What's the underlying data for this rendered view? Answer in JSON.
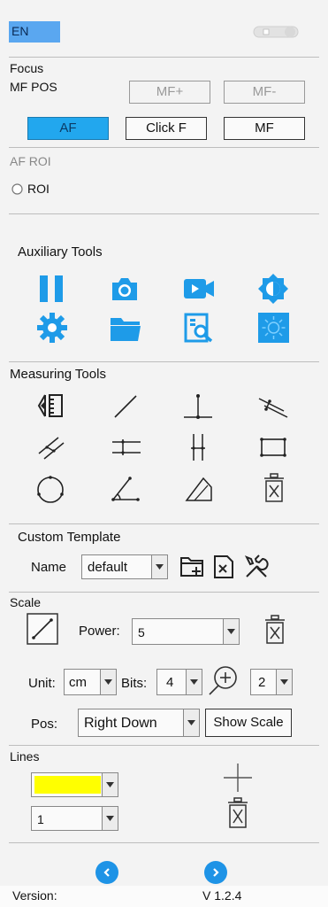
{
  "header": {
    "lang_label": "EN",
    "lang_color": "#5aa7f0"
  },
  "focus": {
    "title": "Focus",
    "mf_pos_label": "MF POS",
    "mf_plus": "MF+",
    "mf_minus": "MF-",
    "af": "AF",
    "click_f": "Click F",
    "mf": "MF",
    "active_color": "#22a7ee"
  },
  "af_roi": {
    "title": "AF ROI",
    "roi_label": "ROI"
  },
  "auxiliary": {
    "title": "Auxiliary Tools",
    "icons": [
      "pause-icon",
      "camera-icon",
      "video-record-icon",
      "contrast-icon",
      "settings-gear-icon",
      "folder-icon",
      "image-search-icon",
      "brightness-icon"
    ],
    "icon_color": "#1e9be8"
  },
  "measuring": {
    "title": "Measuring Tools",
    "icons": [
      "calibrate-icon",
      "line-icon",
      "perpendicular-icon",
      "parallel-distance-icon",
      "parallel-lines-icon",
      "horizontal-lines-icon",
      "vertical-lines-icon",
      "rectangle-icon",
      "circle-icon",
      "angle-icon",
      "polygon-icon",
      "delete-icon"
    ]
  },
  "template": {
    "title": "Custom Template",
    "name_label": "Name",
    "name_value": "default"
  },
  "scale": {
    "title": "Scale",
    "power_label": "Power:",
    "power_value": "5",
    "unit_label": "Unit:",
    "unit_value": "cm",
    "bits_label": "Bits:",
    "bits_value": "4",
    "zoom_value": "2",
    "pos_label": "Pos:",
    "pos_value": "Right Down",
    "show_scale": "Show Scale"
  },
  "lines": {
    "title": "Lines",
    "color_value": "#ffff00",
    "width_value": "1"
  },
  "footer": {
    "version_label": "Version:",
    "version_value": "V 1.2.4"
  }
}
